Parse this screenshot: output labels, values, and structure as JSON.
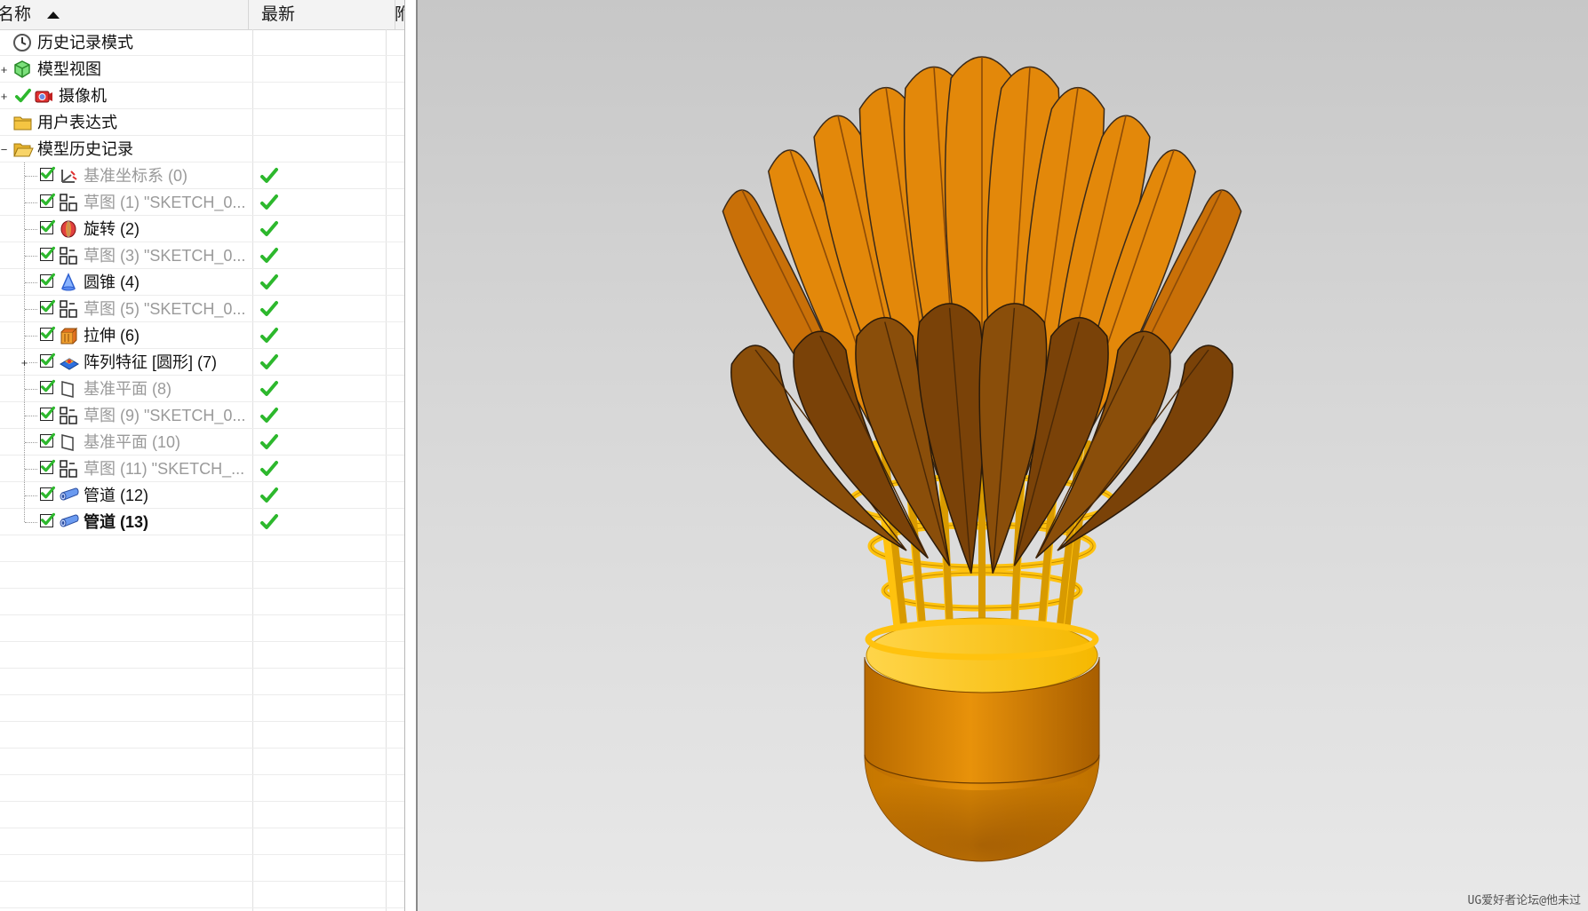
{
  "navigator": {
    "header": {
      "name": "名称",
      "latest": "最新",
      "extra": "附"
    },
    "top_nodes": [
      {
        "label": "历史记录模式",
        "icon": "clock-icon"
      },
      {
        "label": "模型视图",
        "icon": "model-views-icon"
      },
      {
        "label": "摄像机",
        "icon": "camera-icon"
      },
      {
        "label": "用户表达式",
        "icon": "folder-icon"
      },
      {
        "label": "模型历史记录",
        "icon": "folder-open-icon"
      }
    ],
    "features": [
      {
        "label": "基准坐标系 (0)",
        "icon": "datum-csys-icon",
        "dim": true,
        "bold": false,
        "expandable": false
      },
      {
        "label": "草图 (1) \"SKETCH_0...",
        "icon": "sketch-icon",
        "dim": true,
        "bold": false,
        "expandable": false
      },
      {
        "label": "旋转 (2)",
        "icon": "revolve-icon",
        "dim": false,
        "bold": false,
        "expandable": false
      },
      {
        "label": "草图 (3) \"SKETCH_0...",
        "icon": "sketch-icon",
        "dim": true,
        "bold": false,
        "expandable": false
      },
      {
        "label": "圆锥 (4)",
        "icon": "cone-icon",
        "dim": false,
        "bold": false,
        "expandable": false
      },
      {
        "label": "草图 (5) \"SKETCH_0...",
        "icon": "sketch-icon",
        "dim": true,
        "bold": false,
        "expandable": false
      },
      {
        "label": "拉伸 (6)",
        "icon": "extrude-icon",
        "dim": false,
        "bold": false,
        "expandable": false
      },
      {
        "label": "阵列特征 [圆形] (7)",
        "icon": "pattern-feature-icon",
        "dim": false,
        "bold": false,
        "expandable": true
      },
      {
        "label": "基准平面 (8)",
        "icon": "datum-plane-icon",
        "dim": true,
        "bold": false,
        "expandable": false
      },
      {
        "label": "草图 (9) \"SKETCH_0...",
        "icon": "sketch-icon",
        "dim": true,
        "bold": false,
        "expandable": false
      },
      {
        "label": "基准平面 (10)",
        "icon": "datum-plane-icon",
        "dim": true,
        "bold": false,
        "expandable": false
      },
      {
        "label": "草图 (11) \"SKETCH_...",
        "icon": "sketch-icon",
        "dim": true,
        "bold": false,
        "expandable": false
      },
      {
        "label": "管道 (12)",
        "icon": "tube-icon",
        "dim": false,
        "bold": false,
        "expandable": false
      },
      {
        "label": "管道 (13)",
        "icon": "tube-icon",
        "dim": false,
        "bold": true,
        "expandable": false
      }
    ]
  },
  "viewport": {
    "model": "shuttlecock",
    "watermark": "UG爱好者论坛@他未过"
  },
  "colors": {
    "accent_check": "#2db82d",
    "feather_light": "#e8890a",
    "feather_dark": "#8a4a0a",
    "cork": "#e08a00",
    "ring": "#ffc20e"
  }
}
